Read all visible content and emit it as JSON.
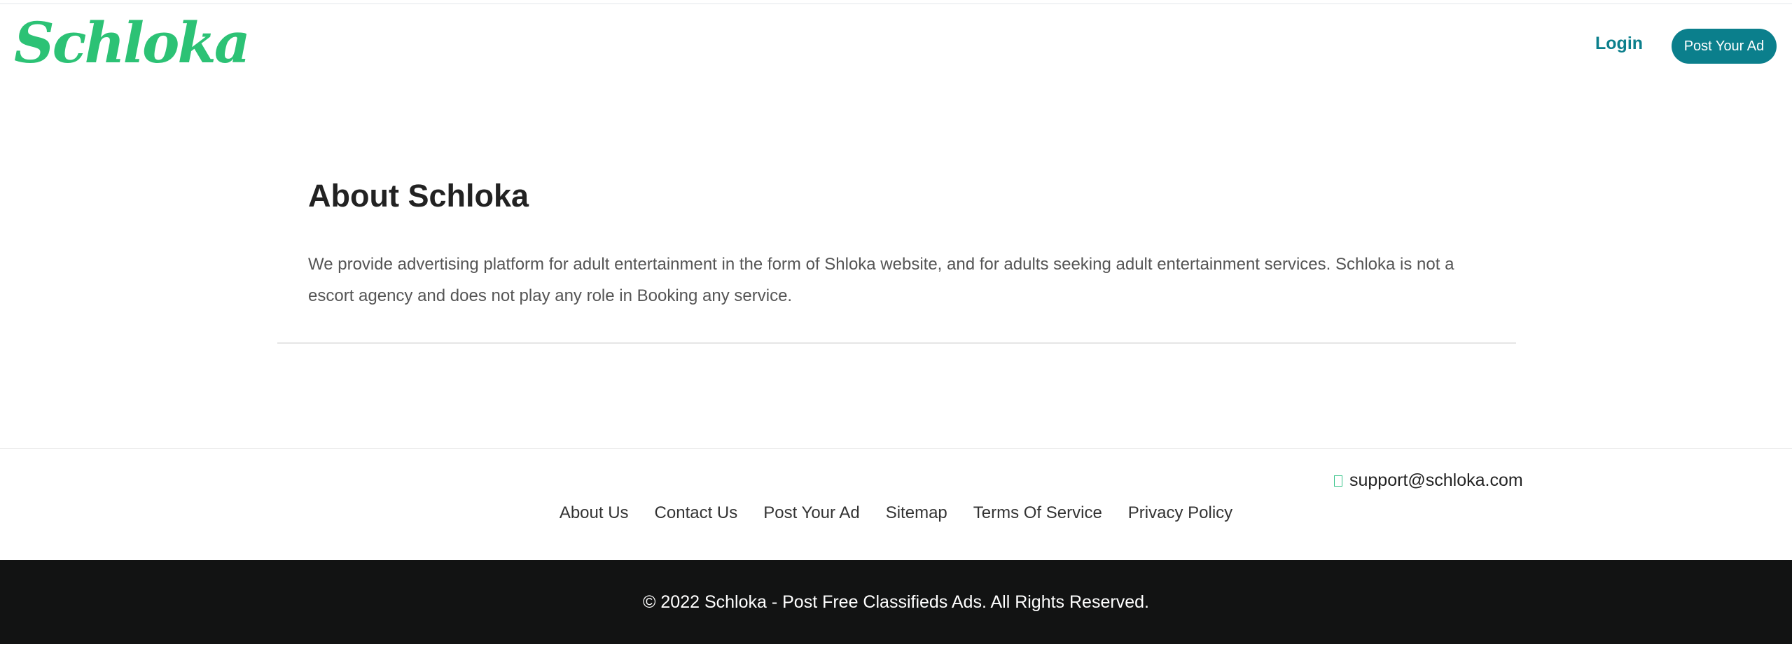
{
  "header": {
    "logo_text": "Schloka",
    "login_label": "Login",
    "post_ad_label": "Post Your Ad"
  },
  "about": {
    "title": "About Schloka",
    "body": "We provide advertising platform for adult entertainment in the form of Shloka website, and for adults seeking adult entertainment services. Schloka is not a escort agency and does not play any role in Booking any service."
  },
  "footer": {
    "email": "support@schloka.com",
    "links": [
      "About Us",
      "Contact Us",
      "Post Your Ad",
      "Sitemap",
      "Terms Of Service",
      "Privacy Policy"
    ],
    "copyright": "© 2022 Schloka - Post Free Classifieds Ads. All Rights Reserved."
  },
  "colors": {
    "brand_green": "#2cc275",
    "accent_teal": "#0b7f8c",
    "footer_bg": "#121313"
  },
  "icons": {
    "email": "envelope-icon"
  }
}
